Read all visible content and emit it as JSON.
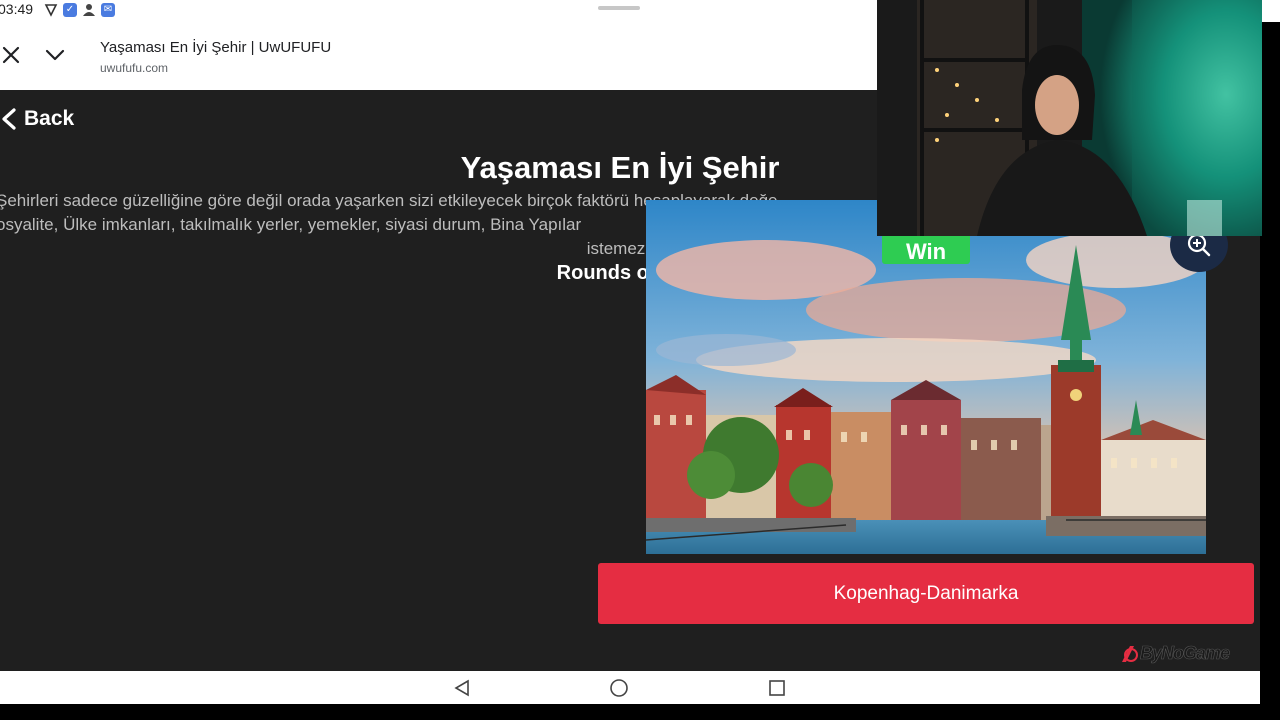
{
  "status_bar": {
    "time": "03:49",
    "icons": [
      "vpn-shield-icon",
      "shield-check-icon",
      "person-icon",
      "message-icon"
    ]
  },
  "browser": {
    "title": "Yaşaması En İyi Şehir | UwUFUFU",
    "url": "uwufufu.com"
  },
  "page": {
    "back_label": "Back",
    "title": "Yaşaması En İyi Şehir",
    "description_line1": "Şehirleri sadece güzelliğine göre değil orada yaşarken sizi etkileyecek birçok faktörü hesaplayarak değe",
    "description_line2": "osyalite, Ülke imkanları, takılmalık yerler, yemekler, siyasi durum, Bina Yapılar",
    "description_line3": "istemez",
    "rounds": "Rounds of 16"
  },
  "candidate": {
    "badge": "Win",
    "name": "Kopenhag-Danimarka",
    "zoom_icon": "zoom-in-icon"
  },
  "watermark": {
    "text": "ByNoGame"
  },
  "colors": {
    "page_bg": "#1f1f1f",
    "accent_red": "#e52d42",
    "win_green": "#2ecc52"
  }
}
